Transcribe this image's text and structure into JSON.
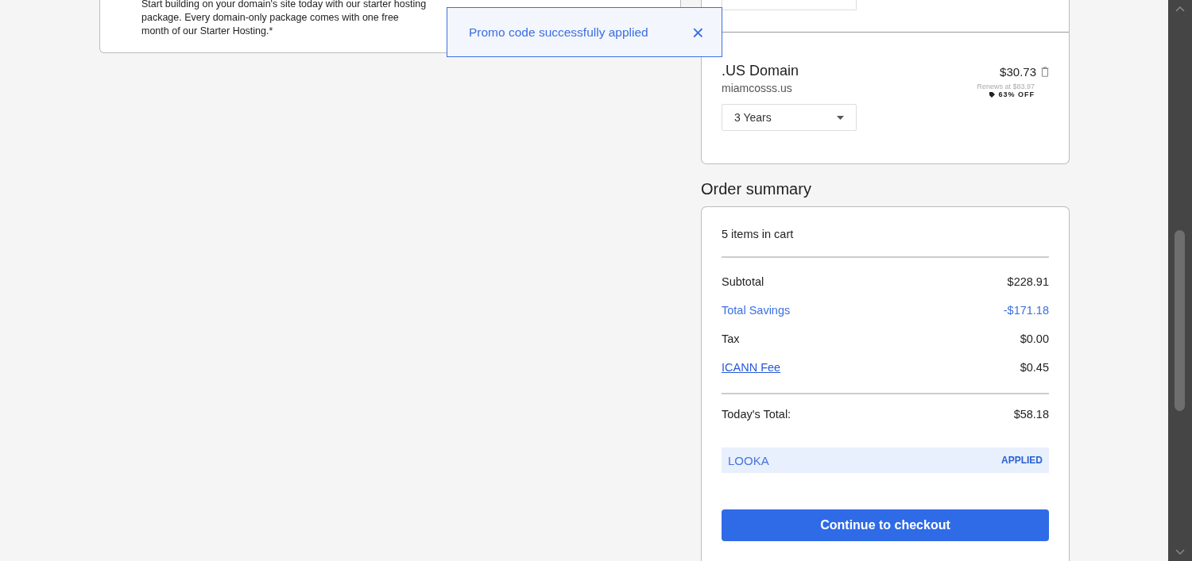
{
  "promo_card": {
    "lines": [
      "Start building on your domain's site today with our starter hosting",
      "package. Every domain-only package comes with one free",
      "month of our Starter Hosting.*"
    ]
  },
  "toast": {
    "message": "Promo code successfully applied",
    "close": "×"
  },
  "cart_items": [
    {
      "name": ".US Domain",
      "domain": "miamcosss.us",
      "price": "$30.73",
      "renews": "Renews at $83.97",
      "discount": "63% OFF",
      "term": "3 Years"
    }
  ],
  "order_summary": {
    "title": "Order summary",
    "count": "5 items in cart",
    "lines": [
      {
        "label": "Subtotal",
        "value": "$228.91",
        "kind": "plain"
      },
      {
        "label": "Total Savings",
        "value": "-$171.18",
        "kind": "savings"
      },
      {
        "label": "Tax",
        "value": "$0.00",
        "kind": "plain"
      },
      {
        "label": "ICANN Fee",
        "value": "$0.45",
        "kind": "link"
      }
    ],
    "total_label": "Today's Total:",
    "total_value": "$58.18",
    "promo": {
      "code": "LOOKA",
      "status": "APPLIED"
    },
    "checkout_button": "Continue to checkout"
  }
}
